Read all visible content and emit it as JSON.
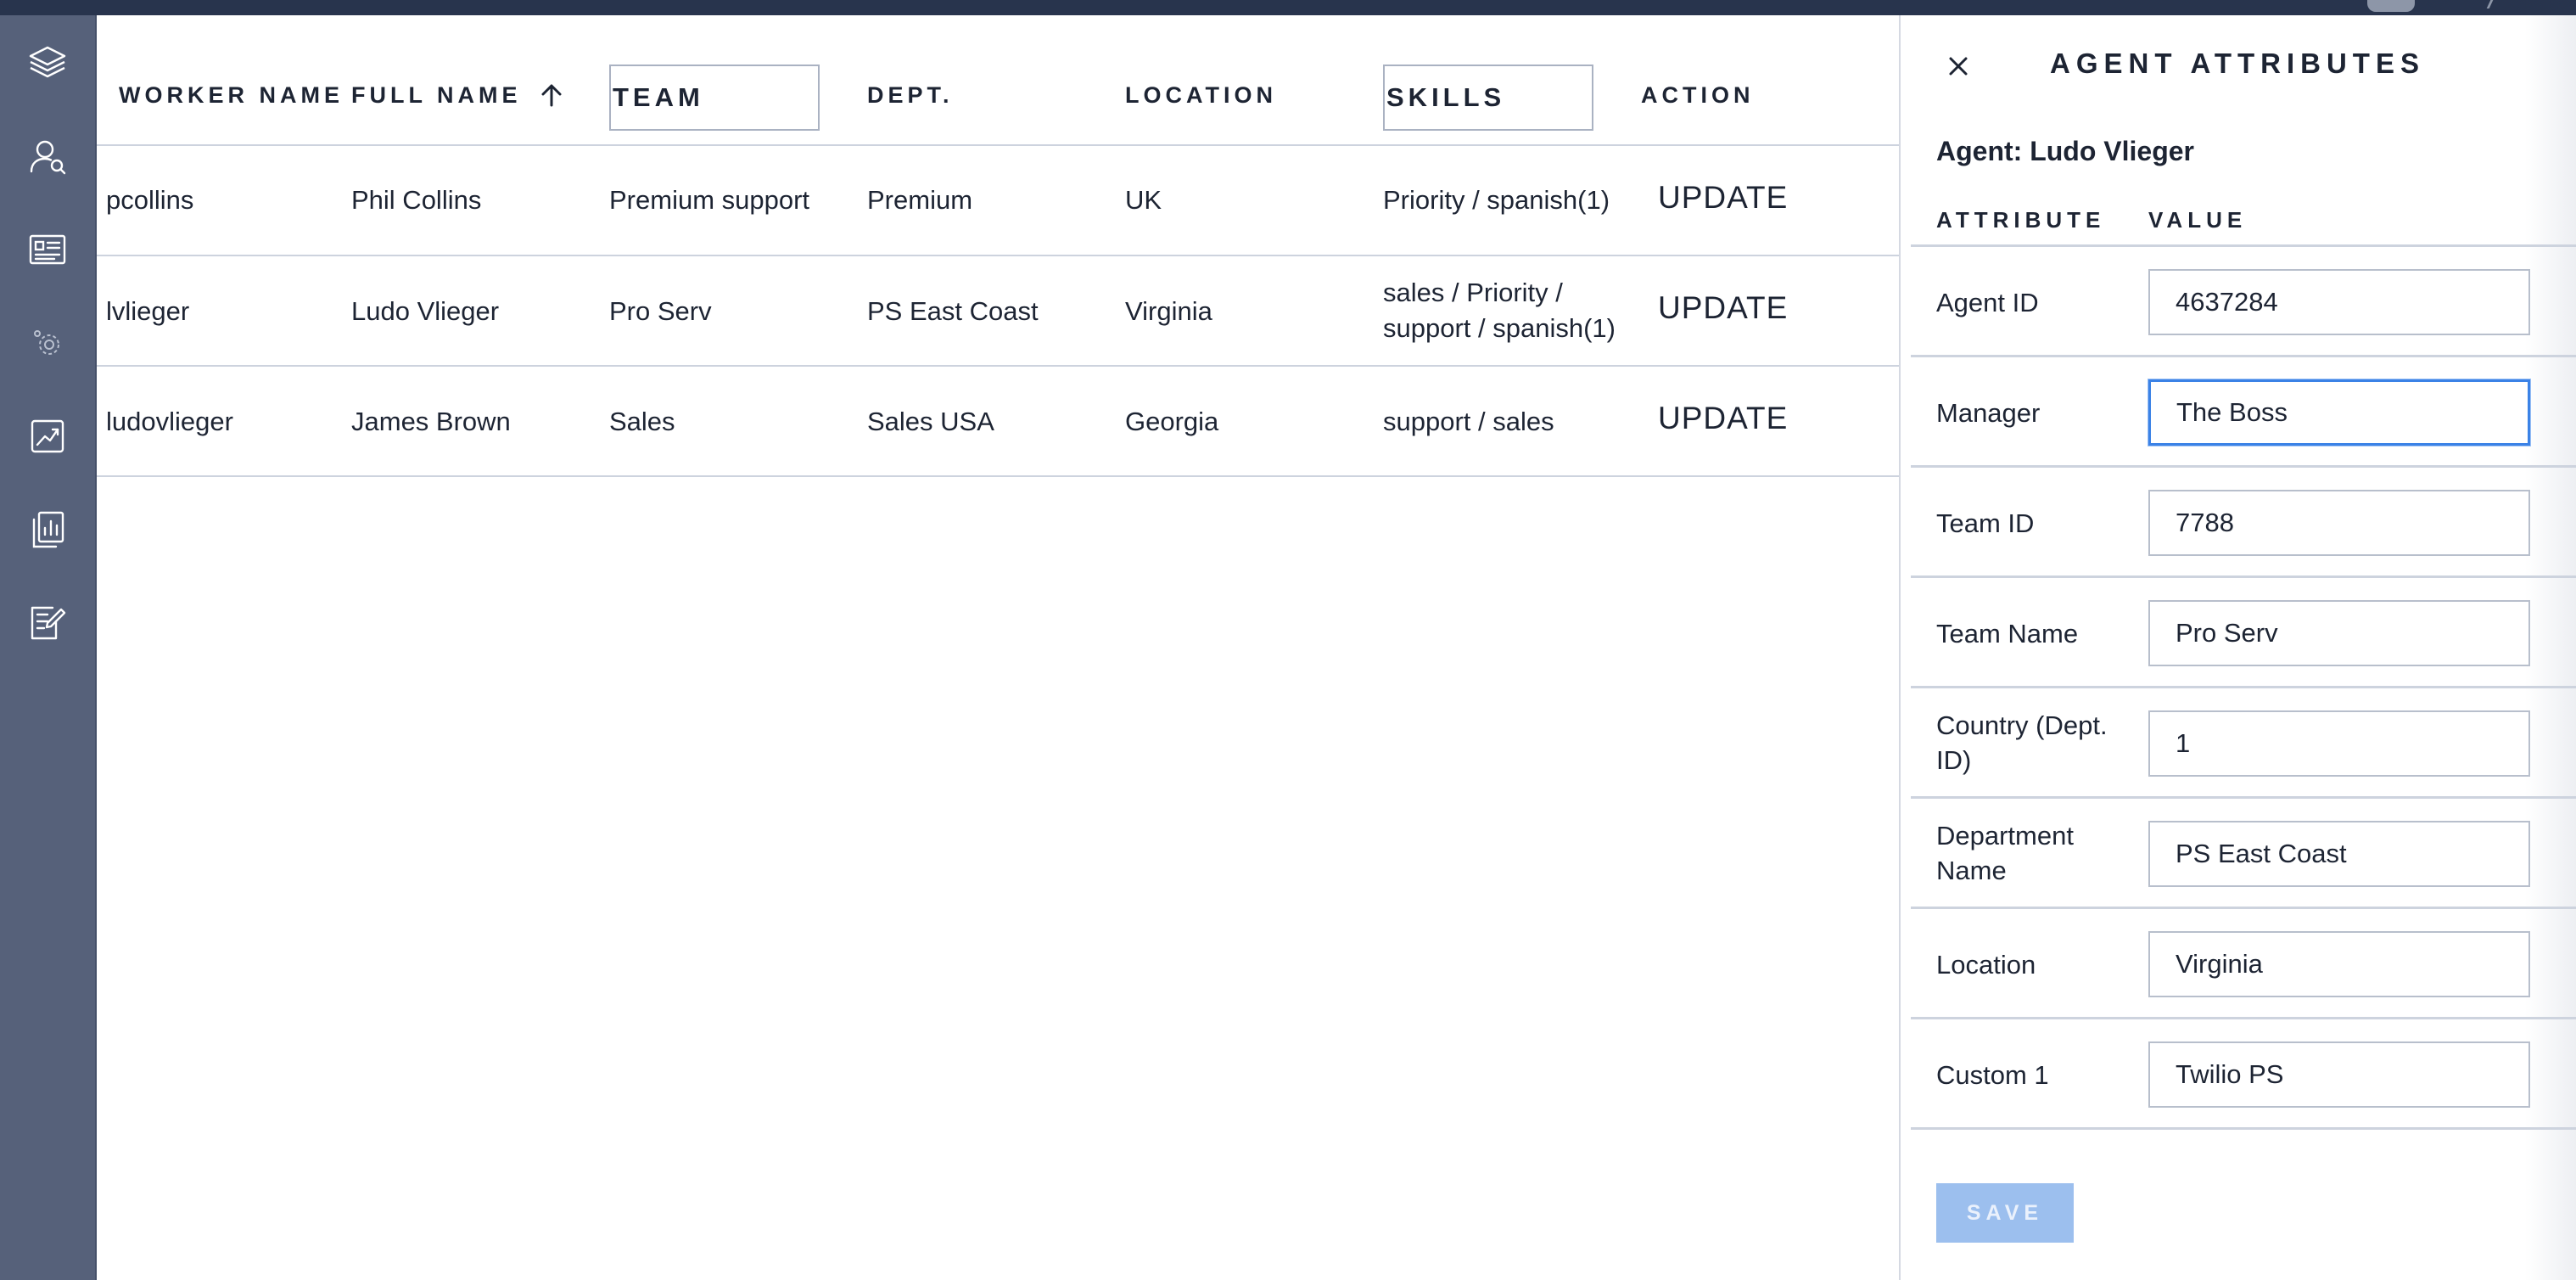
{
  "table": {
    "headers": {
      "worker_name": "WORKER NAME",
      "full_name": "FULL NAME",
      "team": "TEAM",
      "dept": "DEPT.",
      "location": "LOCATION",
      "skills": "SKILLS",
      "action": "ACTION"
    },
    "sort": {
      "column": "full_name",
      "direction": "ascending",
      "icon": "arrow-up-icon"
    },
    "rows": [
      {
        "worker_name": "pcollins",
        "full_name": "Phil Collins",
        "team": "Premium support",
        "dept": "Premium",
        "location": "UK",
        "skills_line1": "Priority / spanish(1)",
        "skills_line2": "",
        "action": "UPDATE"
      },
      {
        "worker_name": "lvlieger",
        "full_name": "Ludo Vlieger",
        "team": "Pro Serv",
        "dept": "PS East Coast",
        "location": "Virginia",
        "skills_line1": "sales / Priority /",
        "skills_line2": "support / spanish(1)",
        "action": "UPDATE"
      },
      {
        "worker_name": "ludovlieger",
        "full_name": "James Brown",
        "team": "Sales",
        "dept": "Sales USA",
        "location": "Georgia",
        "skills_line1": "support / sales",
        "skills_line2": "",
        "action": "UPDATE"
      }
    ]
  },
  "sidebar": {
    "items": [
      {
        "icon": "layers-icon"
      },
      {
        "icon": "user-search-icon"
      },
      {
        "icon": "id-card-icon"
      },
      {
        "icon": "settings-gear-icon"
      },
      {
        "icon": "trend-chart-icon"
      },
      {
        "icon": "report-icon"
      },
      {
        "icon": "edit-form-icon"
      }
    ]
  },
  "panel": {
    "title": "AGENT ATTRIBUTES",
    "agent_label": "Agent: Ludo Vlieger",
    "col_attribute": "ATTRIBUTE",
    "col_value": "VALUE",
    "fields": [
      {
        "label": "Agent ID",
        "value": "4637284"
      },
      {
        "label": "Manager",
        "value": "The Boss"
      },
      {
        "label": "Team ID",
        "value": "7788"
      },
      {
        "label": "Team Name",
        "value": "Pro Serv"
      },
      {
        "label_line1": "Country (Dept.",
        "label_line2": "ID)",
        "value": "1"
      },
      {
        "label_line1": "Department",
        "label_line2": "Name",
        "value": "PS East Coast"
      },
      {
        "label": "Location",
        "value": "Virginia"
      },
      {
        "label": "Custom 1",
        "value": "Twilio PS"
      }
    ],
    "focused_field": "Manager",
    "save_label": "SAVE"
  },
  "colors": {
    "topbar": "#28344d",
    "sidebar": "#56617a",
    "focus_border": "#3b82e6",
    "save_disabled": "#9cbfee"
  }
}
